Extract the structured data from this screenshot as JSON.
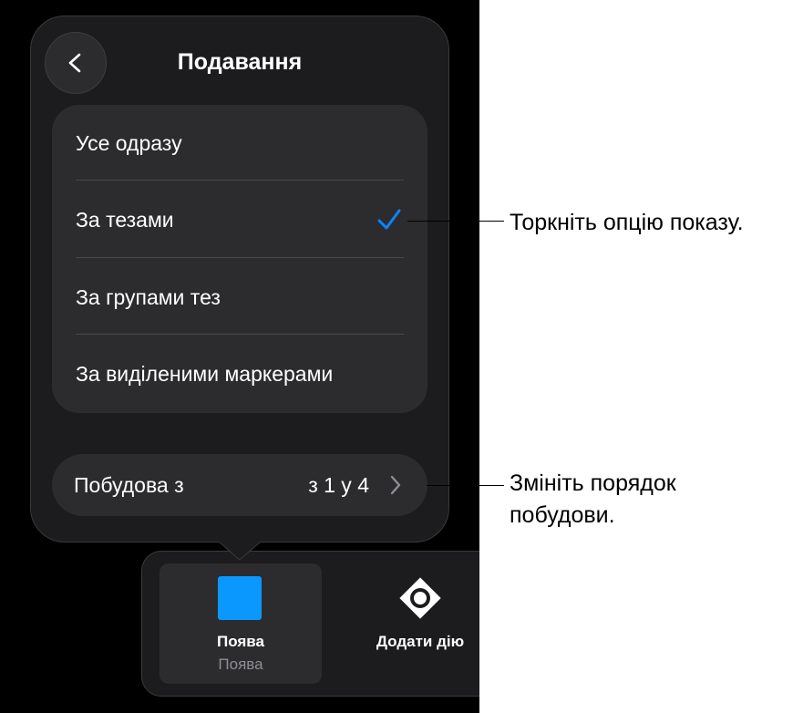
{
  "popover": {
    "title": "Подавання",
    "back_icon": "chevron-left-icon",
    "options": [
      {
        "label": "Усе одразу",
        "selected": false
      },
      {
        "label": "За тезами",
        "selected": true
      },
      {
        "label": "За групами тез",
        "selected": false
      },
      {
        "label": "За виділеними маркерами",
        "selected": false
      }
    ],
    "check_icon": "checkmark-icon",
    "build": {
      "label": "Побудова з",
      "value": "з 1 у 4",
      "icon": "chevron-right-icon"
    }
  },
  "tabbar": {
    "appear": {
      "label": "Поява",
      "sublabel": "Поява",
      "color": "#0a98ff"
    },
    "add_action": {
      "label": "Додати дію",
      "icon": "add-action-icon"
    }
  },
  "callouts": {
    "options": "Торкніть опцію показу.",
    "build_line1": "Змініть порядок",
    "build_line2": "побудови."
  },
  "colors": {
    "accent": "#0a84ff",
    "background": "#000000",
    "panel": "#1c1c1e",
    "row": "#2c2c2e"
  }
}
